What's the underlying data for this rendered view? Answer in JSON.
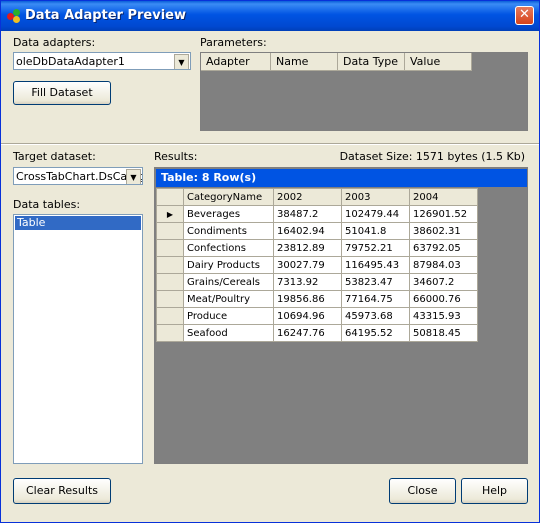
{
  "window": {
    "title": "Data Adapter Preview",
    "close_glyph": "✕"
  },
  "adapters": {
    "label": "Data adapters:",
    "selected": "oleDbDataAdapter1"
  },
  "fill_button": "Fill Dataset",
  "parameters": {
    "label": "Parameters:",
    "columns": [
      "Adapter",
      "Name",
      "Data Type",
      "Value"
    ]
  },
  "target": {
    "label": "Target dataset:",
    "selected": "CrossTabChart.DsCatego"
  },
  "data_tables": {
    "label": "Data tables:",
    "items": [
      "Table"
    ]
  },
  "results": {
    "label": "Results:",
    "dataset_size": "Dataset Size: 1571 bytes (1.5 Kb)",
    "table_title": "Table: 8 Row(s)",
    "columns": [
      "CategoryName",
      "2002",
      "2003",
      "2004"
    ],
    "rows": [
      [
        "Beverages",
        "38487.2",
        "102479.44",
        "126901.52"
      ],
      [
        "Condiments",
        "16402.94",
        "51041.8",
        "38602.31"
      ],
      [
        "Confections",
        "23812.89",
        "79752.21",
        "63792.05"
      ],
      [
        "Dairy Products",
        "30027.79",
        "116495.43",
        "87984.03"
      ],
      [
        "Grains/Cereals",
        "7313.92",
        "53823.47",
        "34607.2"
      ],
      [
        "Meat/Poultry",
        "19856.86",
        "77164.75",
        "66000.76"
      ],
      [
        "Produce",
        "10694.96",
        "45973.68",
        "43315.93"
      ],
      [
        "Seafood",
        "16247.76",
        "64195.52",
        "50818.45"
      ]
    ],
    "current_row_marker": "▶"
  },
  "buttons": {
    "clear": "Clear Results",
    "close": "Close",
    "help": "Help"
  },
  "colors": {
    "title_bar": "#0054e3",
    "selection": "#316ac5",
    "grid_background": "#808080"
  }
}
